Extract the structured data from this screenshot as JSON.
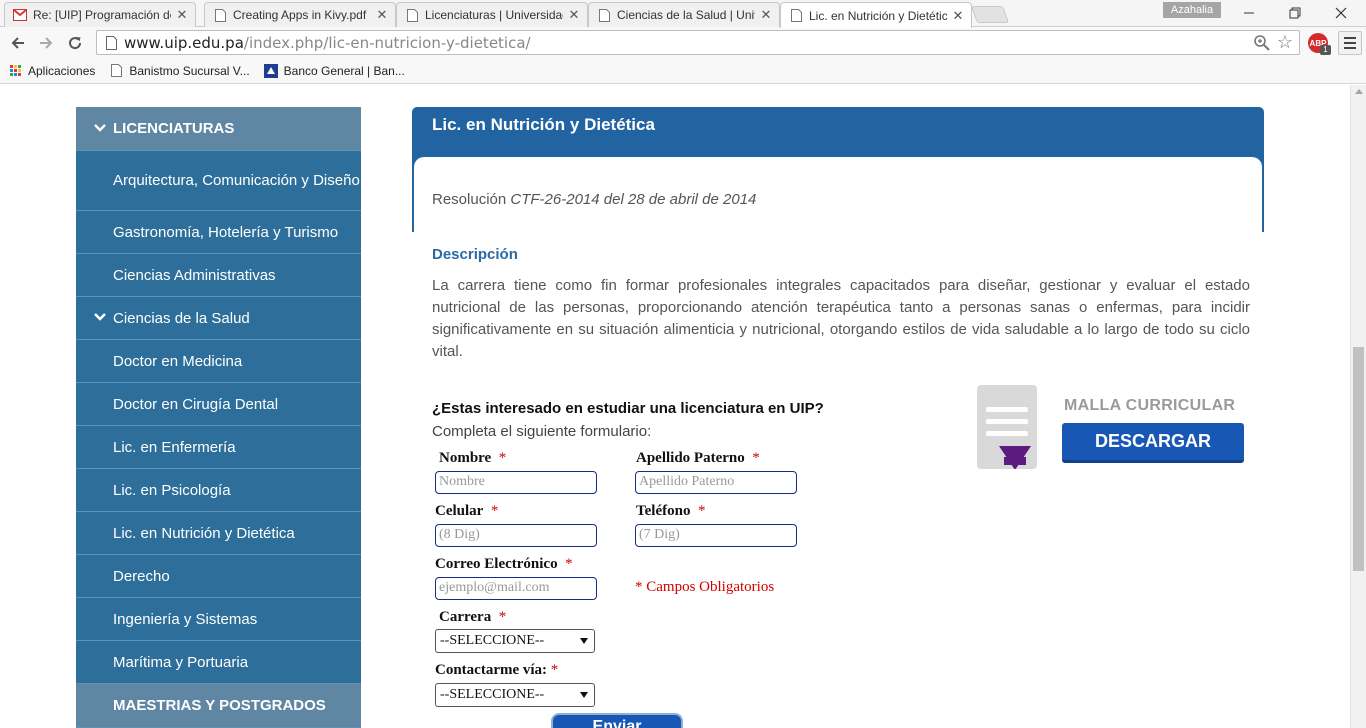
{
  "browser": {
    "tabs": [
      {
        "title": "Re: [UIP] Programación de",
        "icon": "gmail-icon"
      },
      {
        "title": "Creating Apps in Kivy.pdf",
        "icon": "document-icon"
      },
      {
        "title": "Licenciaturas | Universidad",
        "icon": "document-icon"
      },
      {
        "title": "Ciencias de la Salud | Univ",
        "icon": "document-icon"
      },
      {
        "title": "Lic. en Nutrición y Dietétic",
        "icon": "document-icon"
      }
    ],
    "active_tab_index": 4,
    "user_name": "Azahalia",
    "url_host": "www.uip.edu.pa",
    "url_path": "/index.php/lic-en-nutricion-y-dietetica/",
    "adblock_label": "ABP",
    "adblock_count": "1",
    "bookmarks": [
      {
        "label": "Aplicaciones",
        "icon": "apps-grid-icon"
      },
      {
        "label": "Banistmo Sucursal V...",
        "icon": "page-icon"
      },
      {
        "label": "Banco General | Ban...",
        "icon": "bank-icon"
      }
    ]
  },
  "sidebar": {
    "items": [
      {
        "label": "LICENCIATURAS",
        "type": "header",
        "expanded": true
      },
      {
        "label": "Arquitectura, Comunicación y Diseño",
        "type": "tall"
      },
      {
        "label": "Gastronomía, Hotelería y Turismo",
        "type": "item"
      },
      {
        "label": "Ciencias Administrativas",
        "type": "item"
      },
      {
        "label": "Ciencias de la Salud",
        "type": "item",
        "expanded": true
      },
      {
        "label": "Doctor en Medicina",
        "type": "item"
      },
      {
        "label": "Doctor en Cirugía Dental",
        "type": "item"
      },
      {
        "label": "Lic. en Enfermería",
        "type": "item"
      },
      {
        "label": "Lic. en Psicología",
        "type": "item"
      },
      {
        "label": "Lic. en Nutrición y Dietética",
        "type": "item"
      },
      {
        "label": "Derecho",
        "type": "item"
      },
      {
        "label": "Ingeniería y Sistemas",
        "type": "item"
      },
      {
        "label": "Marítima y Portuaria",
        "type": "item"
      },
      {
        "label": "MAESTRIAS Y POSTGRADOS",
        "type": "header"
      }
    ]
  },
  "main": {
    "title": "Lic. en Nutrición y Dietética",
    "resolution_prefix": "Resolución",
    "resolution_value": "CTF-26-2014 del 28 de abril de 2014",
    "description_heading": "Descripción",
    "description_text": "La carrera tiene como fin formar profesionales integrales capacitados para diseñar, gestionar y evaluar el estado nutricional de las personas, proporcionando atención terapéutica tanto a personas sanas o enfermas, para incidir significativamente en su situación alimenticia y nutricional, otorgando estilos de vida saludable a lo largo de todo su ciclo vital."
  },
  "malla": {
    "label": "MALLA CURRICULAR",
    "button": "DESCARGAR"
  },
  "form": {
    "question": "¿Estas interesado en estudiar una licenciatura en UIP?",
    "subtitle": "Completa el siguiente formulario:",
    "required_mark": "*",
    "nombre_label": "Nombre",
    "nombre_placeholder": "Nombre",
    "apellido_label": "Apellido Paterno",
    "apellido_placeholder": "Apellido Paterno",
    "celular_label": "Celular",
    "celular_placeholder": "(8 Dig)",
    "telefono_label": "Teléfono",
    "telefono_placeholder": "(7 Dig)",
    "correo_label": "Correo Electrónico",
    "correo_placeholder": "ejemplo@mail.com",
    "required_note": "* Campos Obligatorios",
    "carrera_label": "Carrera",
    "carrera_value": "--SELECCIONE--",
    "contacto_label": "Contactarme vía:",
    "contacto_value": "--SELECCIONE--",
    "submit": "Enviar"
  },
  "colors": {
    "sidebar_bg": "#2d6f9a",
    "sidebar_header_bg": "#5f87a3",
    "panel_blue": "#2264a2",
    "button_blue": "#1957b4",
    "required_red": "#d10000"
  }
}
